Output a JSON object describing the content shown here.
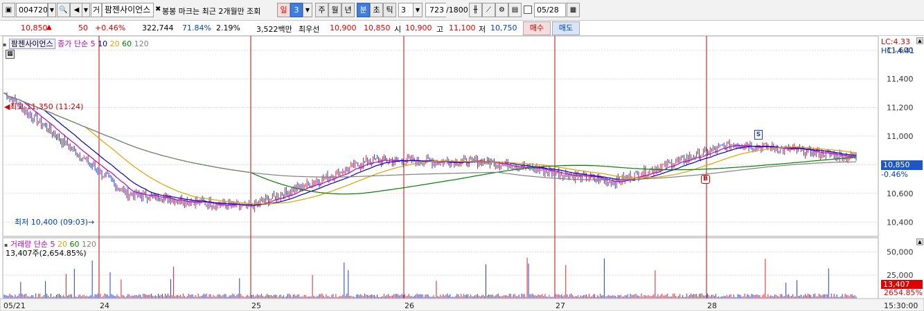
{
  "toolbar": {
    "code": "004720",
    "name": "팜젠사이언스",
    "prefix": "거",
    "notice": "봉봉 마크는 최근 2개월만 조회",
    "periods": [
      "일",
      "3",
      "주",
      "월",
      "년",
      "분",
      "초",
      "틱"
    ],
    "active_period": "분",
    "interval_value": "3",
    "count": "723",
    "count_max": "/1800",
    "date": "05/28"
  },
  "quote": {
    "price": "10,850",
    "change": "50",
    "change_pct": "+0.46%",
    "volume": "322,744",
    "turnover_pct": "71.84%",
    "ratio_pct": "2.19%",
    "amount": "3,522백만",
    "best_label": "최우선",
    "ask": "10,900",
    "bid": "10,850",
    "open_label": "시",
    "open": "10,900",
    "high_label": "고",
    "high": "11,100",
    "low_label": "저",
    "low": "10,750",
    "buy_label": "매수",
    "sell_label": "매도"
  },
  "price_panel": {
    "stock_label": "팜젠사이언스",
    "ma_title": "종가 단순",
    "ma_periods": [
      "5",
      "10",
      "20",
      "60",
      "120"
    ],
    "ma_colors": [
      "#c000c0",
      "#0000c0",
      "#e0a000",
      "#008000",
      "#808080"
    ],
    "high_annotation": "최고 11,350 (11:24)",
    "low_annotation": "최저 10,400 (09:03)",
    "lc": "LC:4.33",
    "hc": "HC:-4.41",
    "y_ticks": [
      "11,600",
      "11,400",
      "11,200",
      "11,000",
      "10,800",
      "10,600",
      "10,400"
    ],
    "current_price": "10,850",
    "current_pct": "-0.46%",
    "sell_marker": "S",
    "buy_marker": "B"
  },
  "volume_panel": {
    "title": "거래량",
    "ma_title": "단순",
    "ma_periods": [
      "5",
      "20",
      "60",
      "120"
    ],
    "value_line": "13,407주(2,654.85%)",
    "y_ticks": [
      "50,000",
      "25,000"
    ],
    "current_volume": "13,407",
    "current_pct": "2654.85%"
  },
  "x_axis": {
    "labels": [
      "05/21",
      "24",
      "25",
      "26",
      "27",
      "28"
    ],
    "time": "15:30:00"
  },
  "chart_data": {
    "type": "line",
    "title": "팜젠사이언스",
    "xlabel": "",
    "ylabel": "",
    "x": [
      "05/21",
      "24",
      "25",
      "26",
      "27",
      "28"
    ],
    "ylim": [
      10300,
      11700
    ],
    "series": [
      {
        "name": "종가",
        "values": [
          11300,
          10600,
          10500,
          10830,
          10820,
          10680,
          10950,
          10850
        ]
      }
    ],
    "colors": {
      "up": "#e0202a",
      "down": "#1e3cc8",
      "day_divider": "#d00000"
    }
  }
}
